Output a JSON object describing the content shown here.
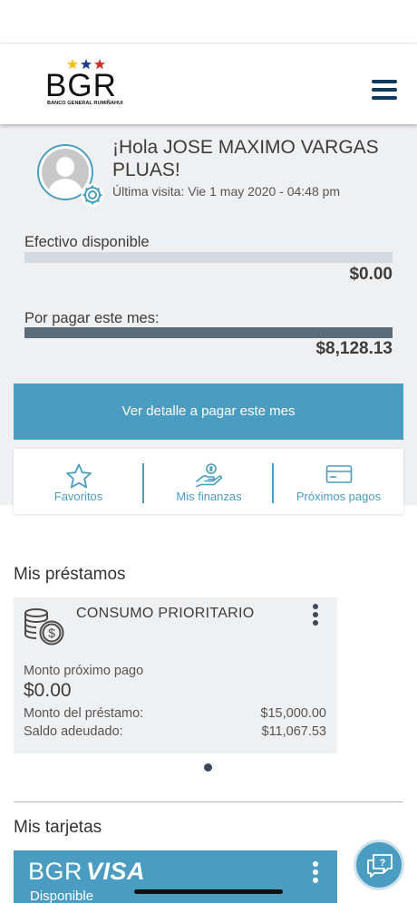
{
  "header": {
    "logo_text": "BGR",
    "logo_subtitle": "BANCO GENERAL RUMIÑAHUI",
    "star_colors": [
      "#f2c21b",
      "#1d3c8f",
      "#d42f2f"
    ]
  },
  "profile": {
    "greeting": "¡Hola JOSE MAXIMO VARGAS PLUAS!",
    "last_visit": "Última visita: Vie 1 may 2020 - 04:48 pm"
  },
  "balances": {
    "available": {
      "label": "Efectivo disponible",
      "value": "$0.00",
      "fill_fraction": 0,
      "track_color": "#d3dae1",
      "fill_color": "#5c6b7a"
    },
    "due": {
      "label": "Por pagar este mes:",
      "value": "$8,128.13",
      "fill_fraction": 1,
      "track_color": "#d3dae1",
      "fill_color": "#5c6b7a"
    }
  },
  "actions": {
    "detail_button": "Ver detalle a pagar este mes"
  },
  "shortcuts": [
    {
      "label": "Favoritos",
      "icon": "star-icon"
    },
    {
      "label": "Mis finanzas",
      "icon": "hand-coin-icon"
    },
    {
      "label": "Próximos pagos",
      "icon": "credit-card-icon"
    }
  ],
  "loans": {
    "title": "Mis préstamos",
    "items": [
      {
        "name": "CONSUMO PRIORITARIO",
        "icon": "coins-icon",
        "next_payment_label": "Monto próximo pago",
        "next_payment_value": "$0.00",
        "loan_amount_label": "Monto del préstamo:",
        "loan_amount_value": "$15,000.00",
        "balance_label": "Saldo adeudado:",
        "balance_value": "$11,067.53"
      }
    ],
    "pager_count": 1,
    "pager_active": 1
  },
  "cards": {
    "title": "Mis tarjetas",
    "items": [
      {
        "brand_prefix": "BGR",
        "brand_name": "VISA",
        "available_label": "Disponible"
      }
    ]
  },
  "colors": {
    "accent": "#4a9dc0",
    "navy": "#0e3a5e",
    "summary_bg": "#eff0f2"
  },
  "chat": {
    "icon": "chat-help-icon"
  }
}
